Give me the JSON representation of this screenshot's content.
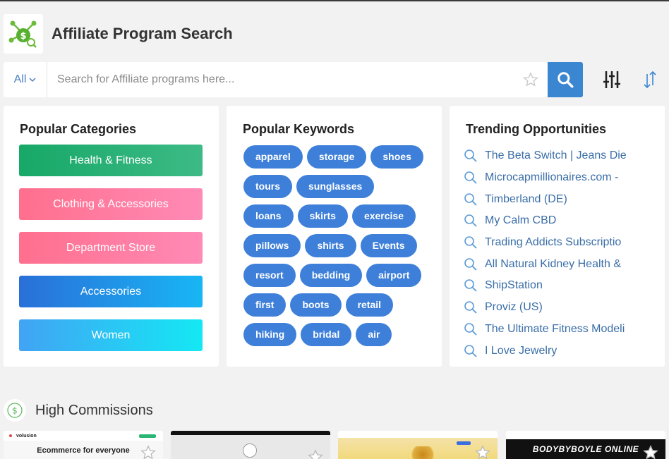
{
  "app": {
    "title": "Affiliate Program Search"
  },
  "search": {
    "scope": "All",
    "placeholder": "Search for Affiliate programs here..."
  },
  "categories": {
    "heading": "Popular Categories",
    "items": [
      {
        "label": "Health & Fitness",
        "gradient": [
          "#17a867",
          "#3dba86"
        ]
      },
      {
        "label": "Clothing & Accessories",
        "gradient": [
          "#ff6f8d",
          "#ff8ab6"
        ]
      },
      {
        "label": "Department Store",
        "gradient": [
          "#ff6f8d",
          "#ff8ab6"
        ]
      },
      {
        "label": "Accessories",
        "gradient": [
          "#2a6fd8",
          "#18b6f5"
        ]
      },
      {
        "label": "Women",
        "gradient": [
          "#42a3f4",
          "#14e8f4"
        ]
      }
    ]
  },
  "keywords": {
    "heading": "Popular Keywords",
    "items": [
      "apparel",
      "storage",
      "shoes",
      "tours",
      "sunglasses",
      "loans",
      "skirts",
      "exercise",
      "pillows",
      "shirts",
      "Events",
      "resort",
      "bedding",
      "airport",
      "first",
      "boots",
      "retail",
      "hiking",
      "bridal",
      "air"
    ]
  },
  "trending": {
    "heading": "Trending Opportunities",
    "items": [
      "The Beta Switch | Jeans Die",
      "Microcapmillionaires.com -",
      "Timberland (DE)",
      "My Calm CBD",
      "Trading Addicts Subscriptio",
      "All Natural Kidney Health &",
      "ShipStation",
      "Proviz (US)",
      "The Ultimate Fitness Modeli",
      "I Love Jewelry"
    ]
  },
  "high_commissions": {
    "title": "High Commissions",
    "cards": [
      {
        "headline": "Ecommerce for everyone",
        "brand": "volusion"
      },
      {
        "headline": ""
      },
      {
        "headline": ""
      },
      {
        "headline": "BODYBYBOYLE ONLINE"
      }
    ]
  },
  "colors": {
    "accent": "#3a86d1",
    "keyword": "#3d7fd9",
    "link": "#3a6ea8"
  }
}
